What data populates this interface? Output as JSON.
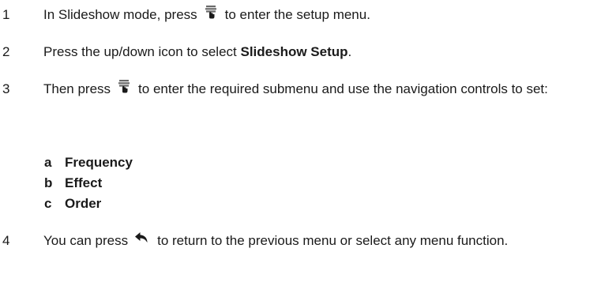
{
  "steps": [
    {
      "number": "1",
      "before": "In Slideshow mode, press",
      "icon": "menu-button-icon",
      "after": "to enter the setup menu."
    },
    {
      "number": "2",
      "before": "Press the up/down icon to select ",
      "bold": "Slideshow Setup",
      "after": "."
    },
    {
      "number": "3",
      "before": "Then press",
      "icon": "menu-button-icon",
      "after": "to enter the required submenu and use the navigation controls to set:",
      "subitems": [
        {
          "letter": "a",
          "label": "Frequency"
        },
        {
          "letter": "b",
          "label": "Effect"
        },
        {
          "letter": "c",
          "label": "Order"
        }
      ]
    },
    {
      "number": "4",
      "before": "You can press",
      "icon": "back-arrow-icon",
      "after": "to return to the previous menu or select any menu function."
    }
  ]
}
